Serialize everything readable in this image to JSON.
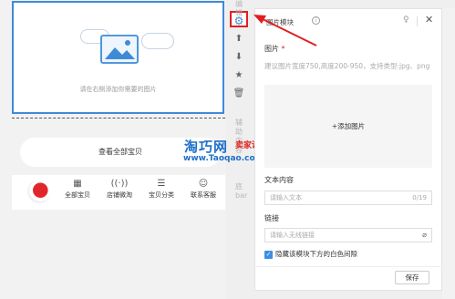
{
  "canvas": {
    "image_hint": "请在右侧添加你需要的图片",
    "view_all": "查看全部宝贝",
    "nav": [
      {
        "label": "全部宝贝",
        "icon": "grid-icon"
      },
      {
        "label": "店铺微淘",
        "icon": "broadcast-icon"
      },
      {
        "label": "宝贝分类",
        "icon": "list-icon"
      },
      {
        "label": "联系客服",
        "icon": "chat-icon"
      }
    ]
  },
  "toolbar": {
    "icons": [
      "gear-icon",
      "arrow-up-icon",
      "arrow-down-icon",
      "star-icon",
      "trash-icon"
    ]
  },
  "side_text": {
    "top": "编辑",
    "mid": "辅助内容",
    "bottom": "底bar"
  },
  "watermark": {
    "brand": "淘巧网",
    "red": "卖家课堂",
    "url": "www.Taoqao.com"
  },
  "panel": {
    "title": "图片模块",
    "image_label": "图片",
    "required_mark": "*",
    "image_help": "建议图片宽度750,高度200-950，支持类型:jpg、png",
    "upload_label": "+添加图片",
    "text_label": "文本内容",
    "text_placeholder": "请输入文本",
    "text_counter": "0/19",
    "link_label": "链接",
    "link_placeholder": "请输入无线链接",
    "hide_gap_label": "隐藏该模块下方的白色间隙",
    "save_label": "保存"
  },
  "colors": {
    "accent": "#3f8ad8",
    "highlight": "#e02020",
    "watermark_blue": "#1e6fc9"
  }
}
